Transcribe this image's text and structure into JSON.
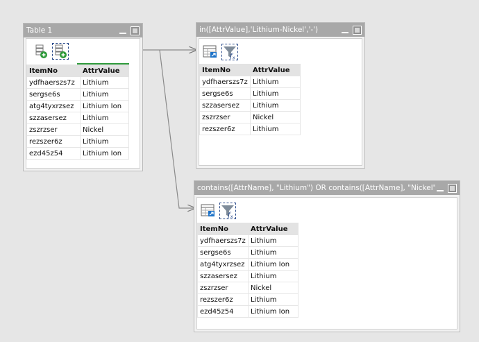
{
  "colors": {
    "title_bar": "#a8a8a8",
    "accent_green": "#2e9a3a",
    "filter_funnel": "#7f8c9a",
    "selection": "#2b4c8c"
  },
  "table1": {
    "title": "Table 1",
    "toolbar": [
      "add-row-icon",
      "add-row-selected-icon"
    ],
    "columns": [
      "ItemNo",
      "AttrValue"
    ],
    "rows": [
      [
        "ydfhaerszs7z",
        "Lithium"
      ],
      [
        "sergse6s",
        "Lithium"
      ],
      [
        "atg4tyxrzsez",
        "Lithium Ion"
      ],
      [
        "szzasersez",
        "Lithium"
      ],
      [
        "zszrzser",
        "Nickel"
      ],
      [
        "rezszer6z",
        "Lithium"
      ],
      [
        "ezd45z54",
        "Lithium Ion"
      ]
    ]
  },
  "filter1": {
    "title": "in([AttrValue],'Lithium-Nickel','-')",
    "toolbar": [
      "table-link-icon",
      "filter-fx-icon"
    ],
    "columns": [
      "ItemNo",
      "AttrValue"
    ],
    "rows": [
      [
        "ydfhaerszs7z",
        "Lithium"
      ],
      [
        "sergse6s",
        "Lithium"
      ],
      [
        "szzasersez",
        "Lithium"
      ],
      [
        "zszrzser",
        "Nickel"
      ],
      [
        "rezszer6z",
        "Lithium"
      ]
    ]
  },
  "filter2": {
    "title": "contains([AttrName], \"Lithium\") OR contains([AttrName], \"Nickel\")",
    "toolbar": [
      "table-link-icon",
      "filter-fx-icon"
    ],
    "columns": [
      "ItemNo",
      "AttrValue"
    ],
    "rows": [
      [
        "ydfhaerszs7z",
        "Lithium"
      ],
      [
        "sergse6s",
        "Lithium"
      ],
      [
        "atg4tyxrzsez",
        "Lithium Ion"
      ],
      [
        "szzasersez",
        "Lithium"
      ],
      [
        "zszrzser",
        "Nickel"
      ],
      [
        "rezszer6z",
        "Lithium"
      ],
      [
        "ezd45z54",
        "Lithium Ion"
      ]
    ]
  }
}
